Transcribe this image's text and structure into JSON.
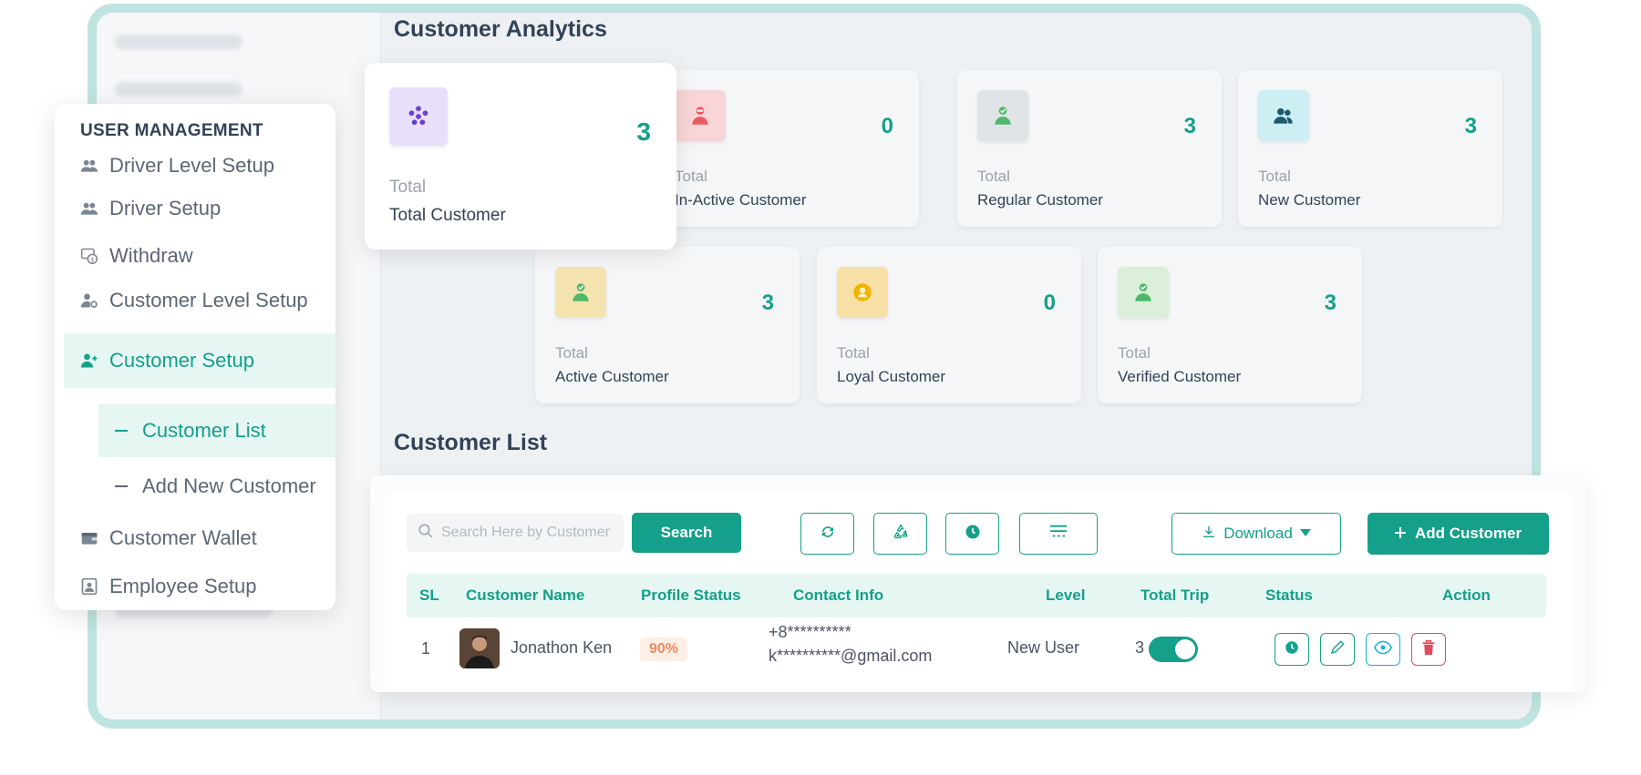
{
  "analytics": {
    "title": "Customer Analytics",
    "cards": [
      {
        "label_top": "Total",
        "label": "Total Customer",
        "value": "3",
        "icon": "users-group-icon",
        "icon_bg": "#e8e0fb",
        "icon_color": "#6b3fd4"
      },
      {
        "label_top": "Total",
        "label": "In-Active Customer",
        "value": "0",
        "icon": "user-minus-icon",
        "icon_bg": "#f8d5d6",
        "icon_color": "#ea5b62"
      },
      {
        "label_top": "Total",
        "label": "Regular Customer",
        "value": "3",
        "icon": "user-check-icon",
        "icon_bg": "#dfe4e6",
        "icon_color": "#4fb86a"
      },
      {
        "label_top": "Total",
        "label": "New Customer",
        "value": "3",
        "icon": "users-icon",
        "icon_bg": "#cdeef3",
        "icon_color": "#1c5a6e"
      },
      {
        "label_top": "Total",
        "label": "Active Customer",
        "value": "3",
        "icon": "user-check-icon",
        "icon_bg": "#f5e3b0",
        "icon_color": "#4fb86a"
      },
      {
        "label_top": "Total",
        "label": "Loyal Customer",
        "value": "0",
        "icon": "user-star-icon",
        "icon_bg": "#f8e1a6",
        "icon_color": "#f0b400"
      },
      {
        "label_top": "Total",
        "label": "Verified Customer",
        "value": "3",
        "icon": "user-check-icon",
        "icon_bg": "#dcefd9",
        "icon_color": "#4fb86a"
      }
    ]
  },
  "sidebar": {
    "section_title": "USER MANAGEMENT",
    "items": [
      {
        "label": "Driver Level Setup",
        "icon": "users-icon"
      },
      {
        "label": "Driver Setup",
        "icon": "users-icon"
      },
      {
        "label": "Withdraw",
        "icon": "withdraw-icon"
      },
      {
        "label": "Customer Level Setup",
        "icon": "user-gear-icon"
      },
      {
        "label": "Customer Setup",
        "icon": "user-plus-icon"
      },
      {
        "label": "Customer Wallet",
        "icon": "wallet-icon"
      },
      {
        "label": "Employee Setup",
        "icon": "id-card-icon"
      }
    ],
    "sub_items": [
      {
        "label": "Customer List"
      },
      {
        "label": "Add New Customer"
      }
    ]
  },
  "customer_list": {
    "title": "Customer List",
    "search_placeholder": "Search Here by Customer",
    "search_label": "Search",
    "download_label": "Download",
    "add_label": "Add Customer",
    "columns": [
      "SL",
      "Customer Name",
      "Profile Status",
      "Contact Info",
      "Level",
      "Total Trip",
      "Status",
      "Action"
    ],
    "rows": [
      {
        "sl": "1",
        "name": "Jonathon Ken",
        "profile_status": "90%",
        "phone": "+8**********",
        "email": "k**********@gmail.com",
        "level": "New User",
        "total_trip": "3",
        "status_on": true
      }
    ]
  },
  "colors": {
    "primary": "#14a08a",
    "primary_light": "#e6f6f3",
    "text": "#334257",
    "danger": "#e04b5a",
    "info": "#1ab0d6"
  }
}
